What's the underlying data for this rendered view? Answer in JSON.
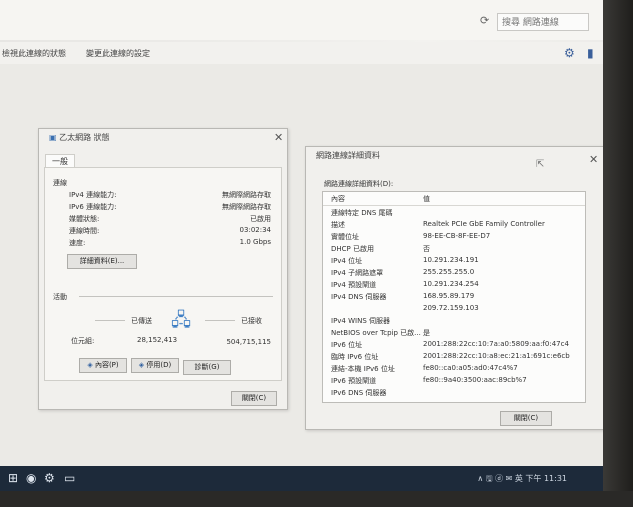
{
  "explorer": {
    "search_placeholder": "搜尋 網路連線",
    "refresh_icon": "refresh-icon",
    "cmd_items": [
      "檢視此連線的狀態",
      "變更此連線的設定"
    ]
  },
  "status_window": {
    "title": "乙太網路 狀態",
    "tab_general": "一般",
    "connection_group": "連線",
    "rows": [
      {
        "label": "IPv4 連線能力:",
        "value": "無網際網路存取"
      },
      {
        "label": "IPv6 連線能力:",
        "value": "無網際網路存取"
      },
      {
        "label": "媒體狀態:",
        "value": "已啟用"
      },
      {
        "label": "連線時間:",
        "value": "03:02:34"
      },
      {
        "label": "速度:",
        "value": "1.0 Gbps"
      }
    ],
    "details_button": "詳細資料(E)...",
    "activity_group": "活動",
    "sent_label": "已傳送",
    "received_label": "已接收",
    "bytes_label": "位元組:",
    "bytes_sent": "28,152,413",
    "bytes_received": "504,715,115",
    "buttons": {
      "properties": "內容(P)",
      "disable": "停用(D)",
      "diagnose": "診斷(G)"
    },
    "close_button": "關閉(C)"
  },
  "details_window": {
    "title": "網路連線詳細資料",
    "section_label": "網路連線詳細資料(D):",
    "header_prop": "內容",
    "header_val": "值",
    "rows": [
      {
        "prop": "連線特定 DNS 尾碼",
        "val": ""
      },
      {
        "prop": "描述",
        "val": "Realtek PCIe GbE Family Controller"
      },
      {
        "prop": "實體位址",
        "val": "98-EE-CB-8F-EE-D7"
      },
      {
        "prop": "DHCP 已啟用",
        "val": "否"
      },
      {
        "prop": "IPv4 位址",
        "val": "10.291.234.191"
      },
      {
        "prop": "IPv4 子網路遮罩",
        "val": "255.255.255.0"
      },
      {
        "prop": "IPv4 預設閘道",
        "val": "10.291.234.254"
      },
      {
        "prop": "IPv4 DNS 伺服器",
        "val": "168.95.89.179"
      },
      {
        "prop": "",
        "val": "209.72.159.103"
      },
      {
        "prop": "IPv4 WINS 伺服器",
        "val": ""
      },
      {
        "prop": "NetBIOS over Tcpip 已啟...",
        "val": "是"
      },
      {
        "prop": "IPv6 位址",
        "val": "2001:288:22cc:10:7a:a0:5809:aa:f0:47c4"
      },
      {
        "prop": "臨時 IPv6 位址",
        "val": "2001:288:22cc:10:a8:ec:21:a1:691c:e6cb"
      },
      {
        "prop": "連結-本機 IPv6 位址",
        "val": "fe80::ca0:a05:ad0:47c4%7"
      },
      {
        "prop": "IPv6 預設閘道",
        "val": "fe80::9a40:3500:aac:89cb%7"
      },
      {
        "prop": "IPv6 DNS 伺服器",
        "val": ""
      }
    ],
    "close_button": "關閉(C)"
  },
  "taskbar": {
    "tray_text": "∧ 🖫 ⓓ ✉ 英 下午 11:31"
  }
}
